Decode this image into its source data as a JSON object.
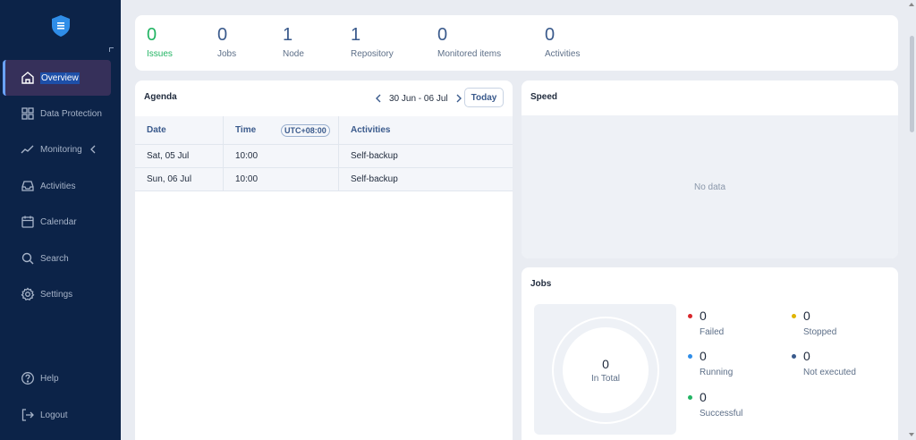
{
  "sidebar": {
    "items": [
      {
        "label": "Overview",
        "icon": "home-icon"
      },
      {
        "label": "Data Protection",
        "icon": "grid-icon"
      },
      {
        "label": "Monitoring",
        "icon": "trend-icon"
      },
      {
        "label": "Activities",
        "icon": "inbox-icon"
      },
      {
        "label": "Calendar",
        "icon": "calendar-icon"
      },
      {
        "label": "Search",
        "icon": "search-icon"
      },
      {
        "label": "Settings",
        "icon": "gear-icon"
      }
    ],
    "bottom": [
      {
        "label": "Help",
        "icon": "help-icon"
      },
      {
        "label": "Logout",
        "icon": "logout-icon"
      }
    ]
  },
  "stats": [
    {
      "value": "0",
      "label": "Issues"
    },
    {
      "value": "0",
      "label": "Jobs"
    },
    {
      "value": "1",
      "label": "Node"
    },
    {
      "value": "1",
      "label": "Repository"
    },
    {
      "value": "0",
      "label": "Monitored items"
    },
    {
      "value": "0",
      "label": "Activities"
    }
  ],
  "agenda": {
    "title": "Agenda",
    "range": "30 Jun - 06 Jul",
    "today": "Today",
    "columns": {
      "date": "Date",
      "time": "Time",
      "tz": "UTC+08:00",
      "activities": "Activities"
    },
    "rows": [
      {
        "date": "Sat, 05 Jul",
        "time": "10:00",
        "activity": "Self-backup"
      },
      {
        "date": "Sun, 06 Jul",
        "time": "10:00",
        "activity": "Self-backup"
      }
    ]
  },
  "speed": {
    "title": "Speed",
    "empty": "No data"
  },
  "jobs": {
    "title": "Jobs",
    "total_value": "0",
    "total_label": "In Total",
    "legend": [
      {
        "value": "0",
        "label": "Failed",
        "color": "#d8272b"
      },
      {
        "value": "0",
        "label": "Stopped",
        "color": "#e0b400"
      },
      {
        "value": "0",
        "label": "Running",
        "color": "#2f8de8"
      },
      {
        "value": "0",
        "label": "Not executed",
        "color": "#3a5a8c"
      },
      {
        "value": "0",
        "label": "Successful",
        "color": "#22b463"
      }
    ]
  },
  "colors": {
    "sidebar_bg": "#0c2348",
    "active_item": "#36305a",
    "accent": "#3a5a8c",
    "success": "#22b463"
  }
}
